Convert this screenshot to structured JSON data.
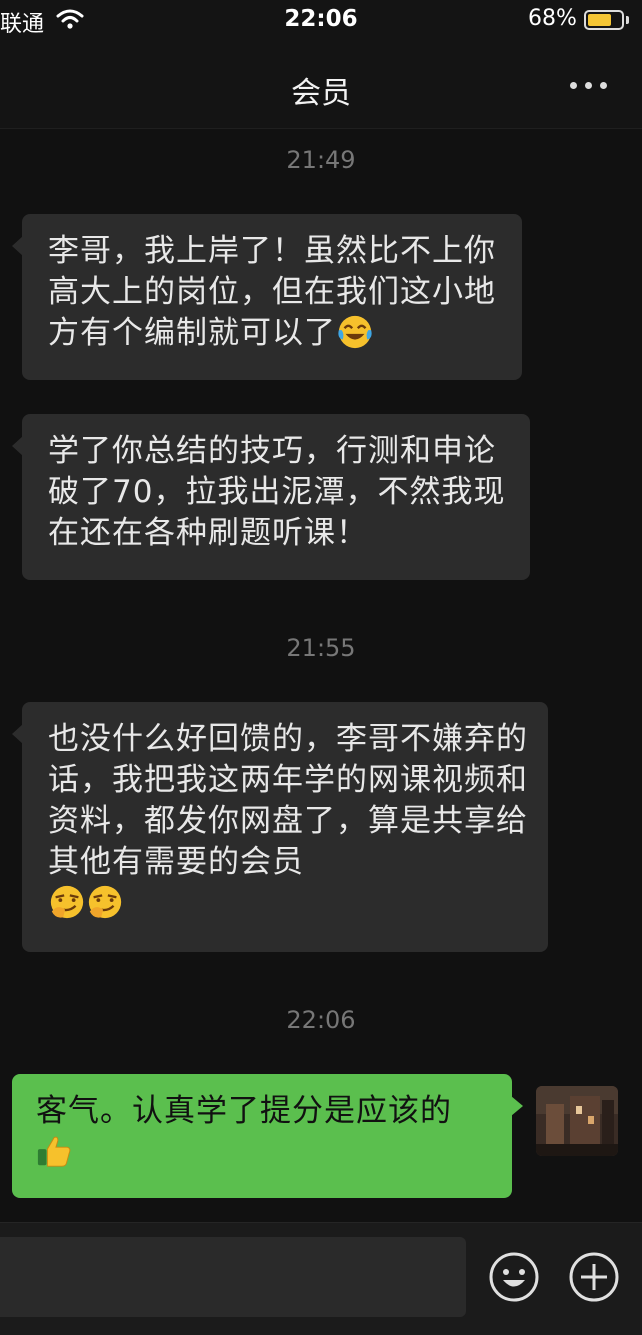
{
  "status_bar": {
    "carrier": "联通",
    "time": "22:06",
    "battery": "68%",
    "battery_level": 0.68,
    "icons": [
      "wifi-icon",
      "battery-icon"
    ]
  },
  "nav": {
    "title": "会员",
    "more_icon": "more-dots-icon"
  },
  "messages": [
    {
      "type": "timestamp",
      "text": "21:49"
    },
    {
      "type": "incoming",
      "text": "李哥，我上岸了！虽然比不上你高大上的岗位，但在我们这小地方有个编制就可以了",
      "emoji": [
        "laugh-cry-emoji"
      ]
    },
    {
      "type": "incoming",
      "text": "学了你总结的技巧，行测和申论破了70，拉我出泥潭，不然我现在还在各种刷题听课！"
    },
    {
      "type": "timestamp",
      "text": "21:55"
    },
    {
      "type": "incoming",
      "text": "也没什么好回馈的，李哥不嫌弃的话，我把我这两年学的网课视频和资料，都发你网盘了，算是共享给其他有需要的会员",
      "emoji": [
        "smirk-emoji",
        "smirk-emoji"
      ]
    },
    {
      "type": "timestamp",
      "text": "22:06"
    },
    {
      "type": "outgoing",
      "text": "客气。认真学了提分是应该的",
      "emoji": [
        "thumbs-up-emoji"
      ]
    }
  ],
  "input_bar": {
    "icons": [
      "emoji-icon",
      "plus-icon"
    ]
  },
  "colors": {
    "background": "#111111",
    "incoming_bubble": "#2c2c2c",
    "outgoing_bubble": "#5bbf4e",
    "timestamp": "#777777"
  }
}
